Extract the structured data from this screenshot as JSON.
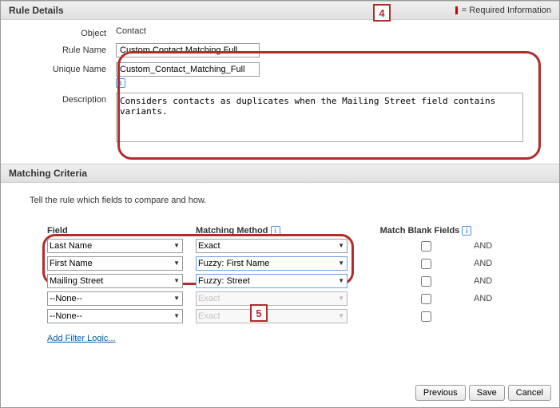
{
  "header": {
    "rule_details": "Rule Details",
    "required_note": "= Required Information"
  },
  "form": {
    "object_label": "Object",
    "object_value": "Contact",
    "rule_name_label": "Rule Name",
    "rule_name_value": "Custom Contact Matching Full",
    "unique_name_label": "Unique Name",
    "unique_name_value": "Custom_Contact_Matching_Full",
    "description_label": "Description",
    "description_value": "Considers contacts as duplicates when the Mailing Street field contains variants."
  },
  "criteria": {
    "header": "Matching Criteria",
    "instruction": "Tell the rule which fields to compare and how.",
    "col_field": "Field",
    "col_method": "Matching Method",
    "col_blank": "Match Blank Fields",
    "rows": [
      {
        "field": "Last Name",
        "method": "Exact",
        "and": "AND"
      },
      {
        "field": "First Name",
        "method": "Fuzzy: First Name",
        "and": "AND"
      },
      {
        "field": "Mailing Street",
        "method": "Fuzzy: Street",
        "and": "AND"
      },
      {
        "field": "--None--",
        "method": "Exact",
        "and": "AND"
      },
      {
        "field": "--None--",
        "method": "Exact",
        "and": ""
      }
    ],
    "add_filter": "Add Filter Logic..."
  },
  "markers": {
    "m4": "4",
    "m5": "5"
  },
  "buttons": {
    "previous": "Previous",
    "save": "Save",
    "cancel": "Cancel"
  }
}
